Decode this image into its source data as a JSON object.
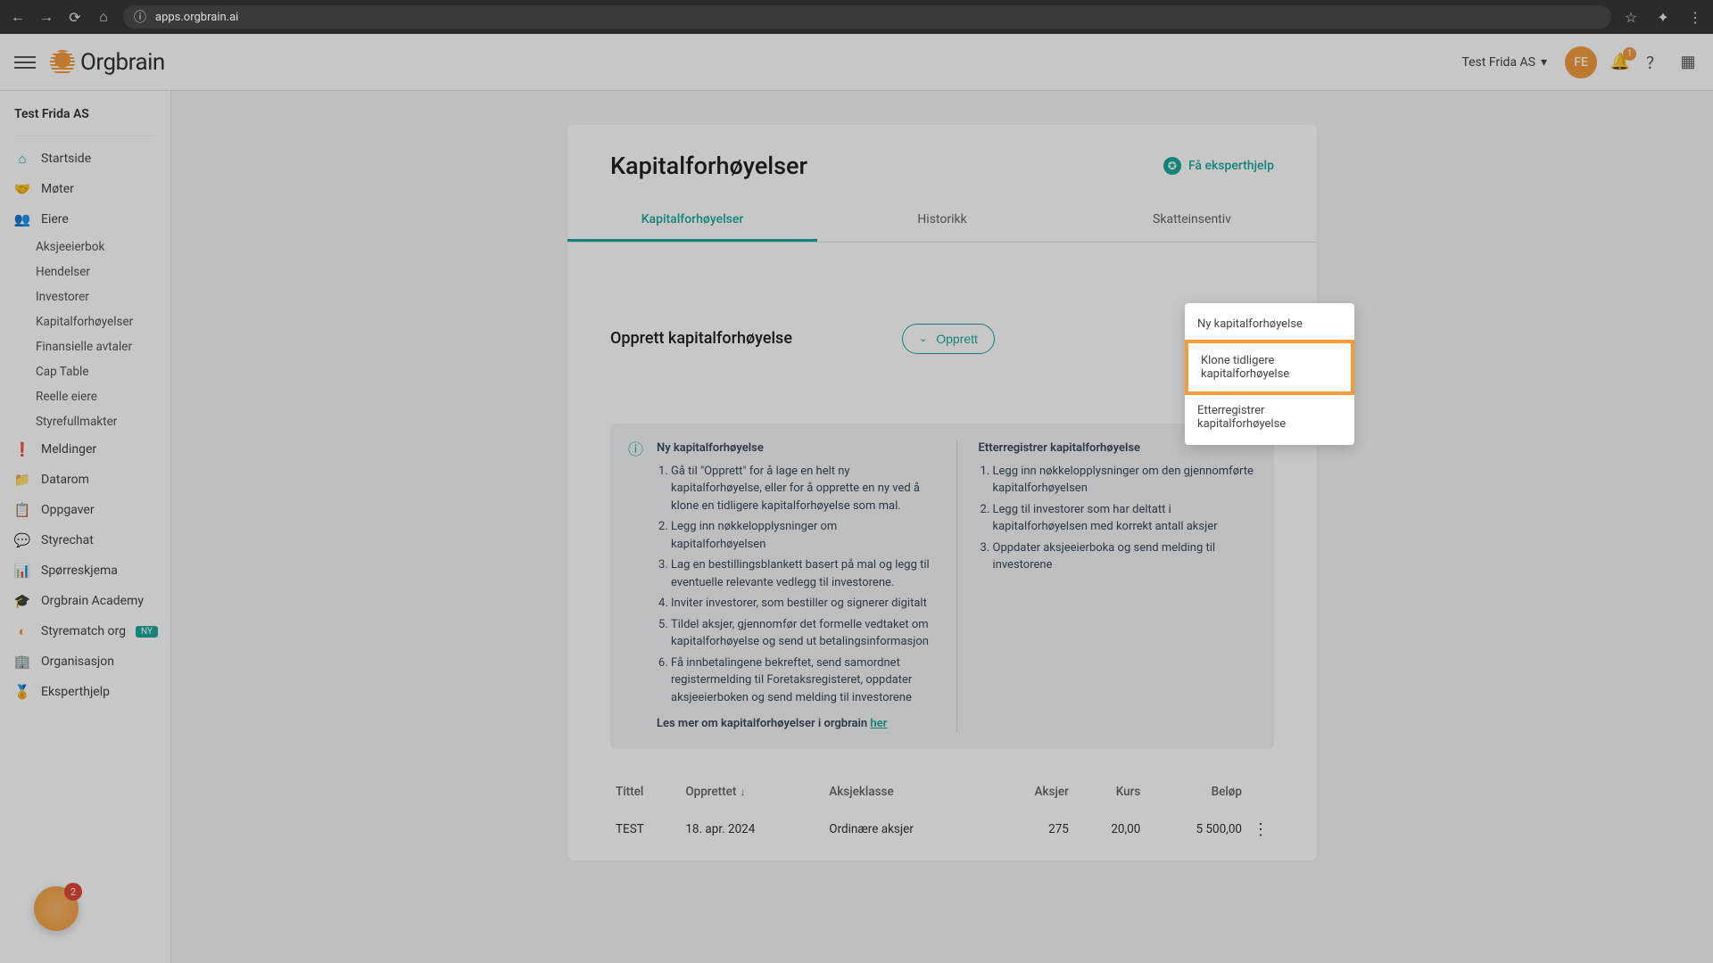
{
  "browser": {
    "url": "apps.orgbrain.ai"
  },
  "header": {
    "logo": "Orgbrain",
    "company": "Test Frida AS",
    "avatar": "FE",
    "notif_count": "1"
  },
  "sidebar": {
    "org": "Test Frida AS",
    "nav": {
      "home": "Startside",
      "meetings": "Møter",
      "owners": "Eiere",
      "owners_children": {
        "sharebook": "Aksjeeierbok",
        "events": "Hendelser",
        "investors": "Investorer",
        "capinc": "Kapitalforhøyelser",
        "fin": "Finansielle avtaler",
        "captable": "Cap Table",
        "realowners": "Reelle eiere",
        "mandates": "Styrefullmakter"
      },
      "messages": "Meldinger",
      "dataroom": "Datarom",
      "tasks": "Oppgaver",
      "boardchat": "Styrechat",
      "surveys": "Spørreskjema",
      "academy": "Orgbrain Academy",
      "match": "Styrematch org",
      "match_badge": "NY",
      "organisation": "Organisasjon",
      "experthelp": "Eksperthjelp"
    }
  },
  "page": {
    "title": "Kapitalforhøyelser",
    "expert_link": "Få eksperthjelp",
    "tabs": {
      "t1": "Kapitalforhøyelser",
      "t2": "Historikk",
      "t3": "Skatteinsentiv"
    },
    "section_title": "Opprett kapitalforhøyelse",
    "create_btn": "Opprett",
    "dropdown": {
      "new": "Ny kapitalforhøyelse",
      "clone": "Klone tidligere kapitalforhøyelse",
      "post": "Etterregistrer kapitalforhøyelse"
    },
    "info": {
      "left_title": "Ny kapitalforhøyelse",
      "left_steps": [
        "Gå til \"Opprett\" for å lage en helt ny kapitalforhøyelse, eller for å opprette en ny ved å klone en tidligere kapitalforhøyelse som mal.",
        "Legg inn nøkkelopplysninger om kapitalforhøyelsen",
        "Lag en bestillingsblankett basert på mal og legg til eventuelle relevante vedlegg til investorene.",
        "Inviter investorer, som bestiller og signerer digitalt",
        "Tildel aksjer, gjennomfør det formelle vedtaket om kapitalforhøyelse og send ut betalingsinformasjon",
        "Få innbetalingene bekreftet, send samordnet registermelding til Foretaksregisteret, oppdater aksjeeierboken og send melding til investorene"
      ],
      "left_more": "Les mer om kapitalforhøyelser i orgbrain ",
      "left_more_link": "her",
      "right_title": "Etterregistrer kapitalforhøyelse",
      "right_steps": [
        "Legg inn nøkkelopplysninger om den gjennomførte kapitalforhøyelsen",
        "Legg til investorer som har deltatt i kapitalforhøyelsen med korrekt antall aksjer",
        "Oppdater aksjeeierboka og send melding til investorene"
      ]
    },
    "table": {
      "headers": {
        "title": "Tittel",
        "created": "Opprettet",
        "class": "Aksjeklasse",
        "shares": "Aksjer",
        "rate": "Kurs",
        "amount": "Beløp"
      },
      "rows": [
        {
          "title": "TEST",
          "created": "18. apr. 2024",
          "class": "Ordinære aksjer",
          "shares": "275",
          "rate": "20,00",
          "amount": "5 500,00"
        }
      ]
    }
  },
  "chat": {
    "count": "2"
  }
}
